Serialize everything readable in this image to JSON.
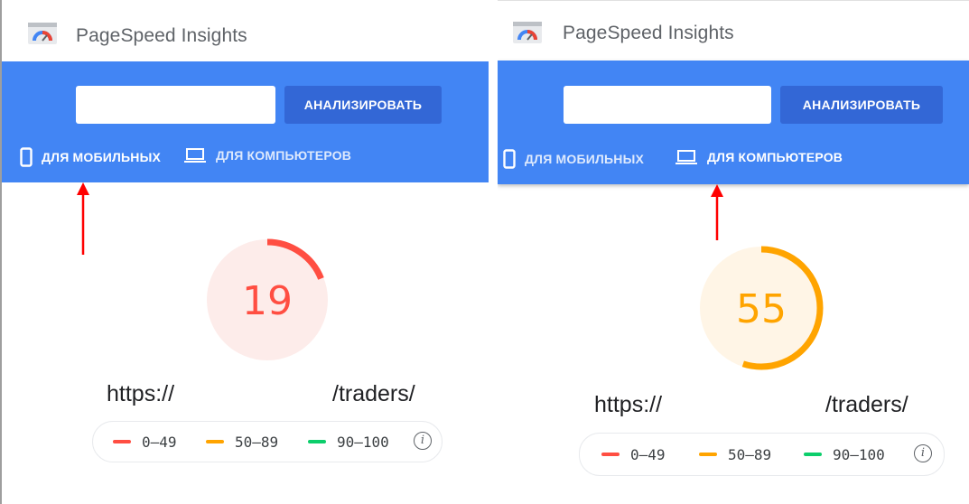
{
  "app": {
    "title": "PageSpeed Insights"
  },
  "search": {
    "url_value": "",
    "analyze_label": "АНАЛИЗИРОВАТЬ"
  },
  "tabs": {
    "mobile_label": "ДЛЯ МОБИЛЬНЫХ",
    "desktop_label": "ДЛЯ КОМПЬЮТЕРОВ"
  },
  "panels": [
    {
      "active_tab": "mobile",
      "score": "19",
      "score_value": 19,
      "score_status": "fail",
      "url_prefix": "https://",
      "url_suffix": "/traders/"
    },
    {
      "active_tab": "desktop",
      "score": "55",
      "score_value": 55,
      "score_status": "average",
      "url_prefix": "https://",
      "url_suffix": "/traders/"
    }
  ],
  "legend": {
    "fail": "0–49",
    "average": "50–89",
    "pass": "90–100",
    "info_icon": "info-icon"
  },
  "colors": {
    "brand_blue": "#4285f4",
    "button_blue": "#3367d6",
    "fail": "#ff4e42",
    "fail_bg": "#fdecea",
    "average": "#ffa400",
    "average_bg": "#fff5e6",
    "pass": "#0cce6b",
    "arrow": "#ff0000"
  }
}
